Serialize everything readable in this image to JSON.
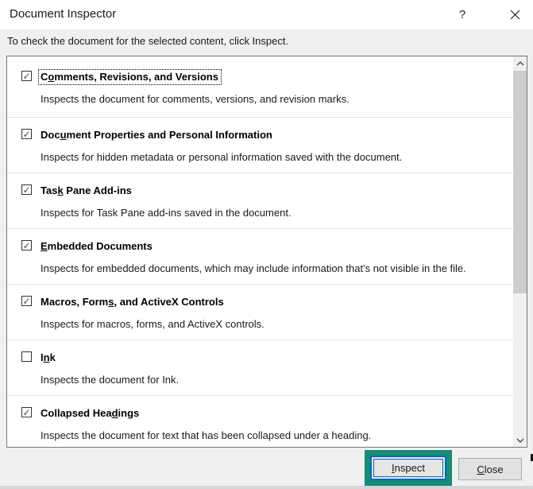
{
  "window": {
    "title": "Document Inspector",
    "help_icon": "?",
    "close_icon": "close"
  },
  "instruction": "To check the document for the selected content, click Inspect.",
  "list": {
    "items": [
      {
        "checked": true,
        "check_glyph": "✓",
        "title_pre": "C",
        "title_key": "o",
        "title_post": "mments, Revisions, and Versions",
        "title_full": "Comments, Revisions, and Versions",
        "description": "Inspects the document for comments, versions, and revision marks."
      },
      {
        "checked": true,
        "check_glyph": "✓",
        "title_pre": "Doc",
        "title_key": "u",
        "title_post": "ment Properties and Personal Information",
        "title_full": "Document Properties and Personal Information",
        "description": "Inspects for hidden metadata or personal information saved with the document."
      },
      {
        "checked": true,
        "check_glyph": "✓",
        "title_pre": "Tas",
        "title_key": "k",
        "title_post": " Pane Add-ins",
        "title_full": "Task Pane Add-ins",
        "description": "Inspects for Task Pane add-ins saved in the document."
      },
      {
        "checked": true,
        "check_glyph": "✓",
        "title_pre": "",
        "title_key": "E",
        "title_post": "mbedded Documents",
        "title_full": "Embedded Documents",
        "description": "Inspects for embedded documents, which may include information that's not visible in the file."
      },
      {
        "checked": true,
        "check_glyph": "✓",
        "title_pre": "Macros, Form",
        "title_key": "s",
        "title_post": ", and ActiveX Controls",
        "title_full": "Macros, Forms, and ActiveX Controls",
        "description": "Inspects for macros, forms, and ActiveX controls."
      },
      {
        "checked": false,
        "check_glyph": "",
        "title_pre": "I",
        "title_key": "n",
        "title_post": "k",
        "title_full": "Ink",
        "description": "Inspects the document for Ink."
      },
      {
        "checked": true,
        "check_glyph": "✓",
        "title_pre": "Collapsed Hea",
        "title_key": "d",
        "title_post": "ings",
        "title_full": "Collapsed Headings",
        "description": "Inspects the document for text that has been collapsed under a heading."
      }
    ]
  },
  "buttons": {
    "inspect": {
      "label_pre": "",
      "label_key": "I",
      "label_post": "nspect",
      "label_full": "Inspect",
      "highlighted": true
    },
    "close": {
      "label_pre": "",
      "label_key": "C",
      "label_post": "lose",
      "label_full": "Close"
    }
  },
  "colors": {
    "highlight_green": "#178C76",
    "default_button_blue": "#0067B8",
    "body_gray": "#F0F0F0",
    "scroll_thumb": "#CDCDCD"
  }
}
